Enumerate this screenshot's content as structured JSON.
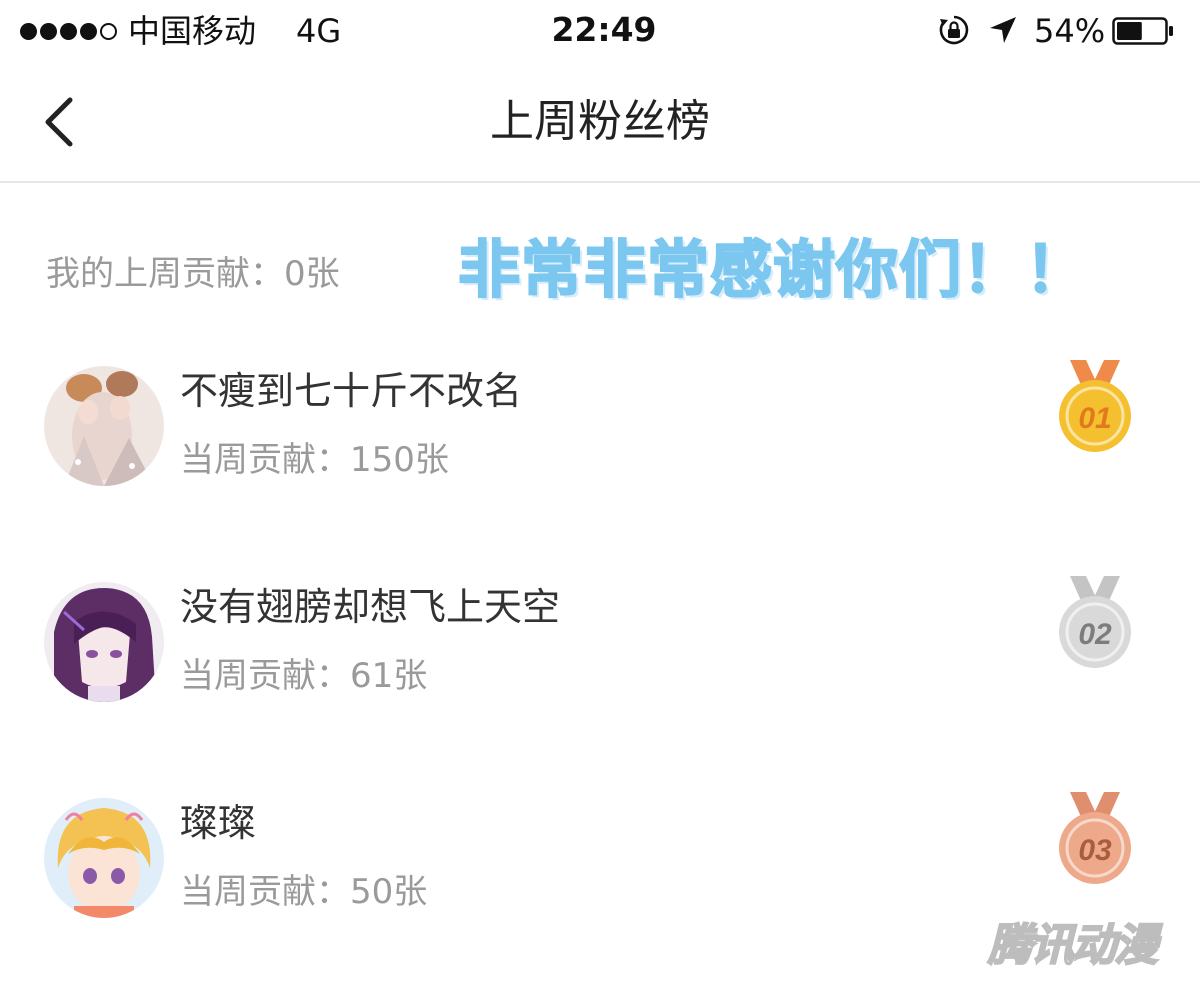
{
  "status_bar": {
    "carrier": "中国移动",
    "network": "4G",
    "time": "22:49",
    "battery_percent": "54%",
    "battery_level": 0.54,
    "icons": [
      "signal-dots-icon",
      "orientation-lock-icon",
      "location-arrow-icon",
      "battery-icon"
    ]
  },
  "nav": {
    "title": "上周粉丝榜",
    "back_icon": "chevron-left-icon"
  },
  "my_contribution": "我的上周贡献：0张",
  "banner_text": "非常非常感谢你们！！",
  "ranking": [
    {
      "name": "不瘦到七十斤不改名",
      "contribution": "当周贡献：150张",
      "medal_label": "01",
      "medal_color": "#f5c030",
      "ribbon_color": "#ef8a4a"
    },
    {
      "name": "没有翅膀却想飞上天空",
      "contribution": "当周贡献：61张",
      "medal_label": "02",
      "medal_color": "#d9d9d9",
      "ribbon_color": "#c4c4c4"
    },
    {
      "name": "璨璨",
      "contribution": "当周贡献：50张",
      "medal_label": "03",
      "medal_color": "#eda98a",
      "ribbon_color": "#e08f6e"
    }
  ],
  "watermark": "腾讯动漫",
  "colors": {
    "banner": "#7cc7f0",
    "secondary_text": "#9a9a9a",
    "divider": "#e6e6e6"
  }
}
